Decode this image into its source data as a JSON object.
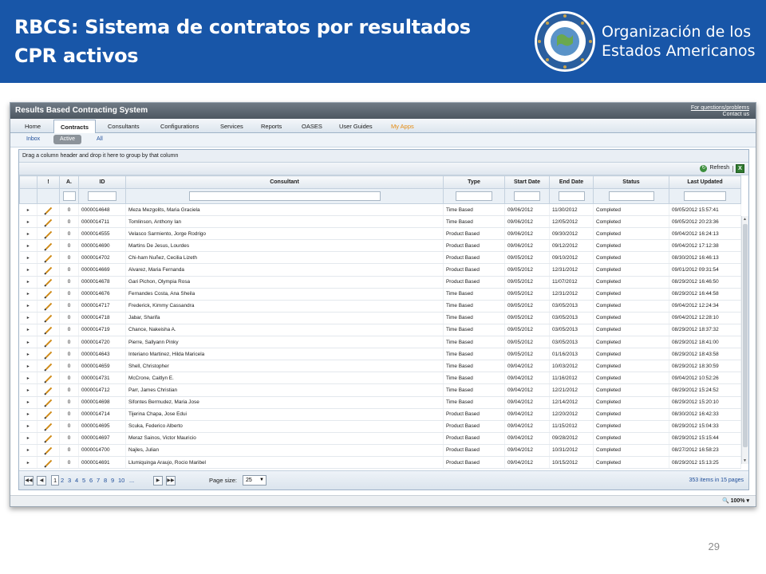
{
  "slide": {
    "title_line1": "RBCS: Sistema de contratos por resultados",
    "title_line2": "CPR activos",
    "org_line1": "Organización de los",
    "org_line2": "Estados Americanos",
    "page_number": "29"
  },
  "app": {
    "title": "Results Based Contracting System",
    "help_line1": "For questions/problems",
    "help_line2": "Contact us"
  },
  "menu": [
    "Home",
    "Contracts",
    "Consultants",
    "Configurations",
    "Services",
    "Reports",
    "OASES",
    "User Guides",
    "My Apps"
  ],
  "subtabs": [
    "Inbox",
    "Active",
    "All"
  ],
  "grid": {
    "group_hint": "Drag a column header and drop it here to group by that column",
    "refresh_label": "Refresh",
    "columns": [
      "!",
      "A.",
      "ID",
      "Consultant",
      "Type",
      "Start Date",
      "End Date",
      "Status",
      "Last Updated"
    ],
    "rows": [
      [
        "0",
        "0000014648",
        "Meza Mezgolits, Maria Graciela",
        "Time Based",
        "09/06/2012",
        "11/30/2012",
        "Completed",
        "09/05/2012 15:57:41"
      ],
      [
        "0",
        "0000014711",
        "Tomlinson, Anthony Ian",
        "Time Based",
        "09/06/2012",
        "12/05/2012",
        "Completed",
        "09/05/2012 20:23:36"
      ],
      [
        "0",
        "0000014555",
        "Velasco Sarmiento, Jorge Rodrigo",
        "Product Based",
        "09/06/2012",
        "09/30/2012",
        "Completed",
        "09/04/2012 16:24:13"
      ],
      [
        "0",
        "0000014690",
        "Martins De Jesus, Lourdes",
        "Product Based",
        "09/06/2012",
        "09/12/2012",
        "Completed",
        "09/04/2012 17:12:38"
      ],
      [
        "0",
        "0000014702",
        "Chi-ham Nuñez, Cecilia Lizeth",
        "Product Based",
        "09/05/2012",
        "09/10/2012",
        "Completed",
        "08/30/2012 16:46:13"
      ],
      [
        "0",
        "0000014669",
        "Alvarez, Maria Fernanda",
        "Product Based",
        "09/05/2012",
        "12/31/2012",
        "Completed",
        "09/01/2012 09:31:54"
      ],
      [
        "0",
        "0000014678",
        "Gari Pichon, Olympia Rosa",
        "Product Based",
        "09/05/2012",
        "11/07/2012",
        "Completed",
        "08/29/2012 16:46:50"
      ],
      [
        "0",
        "0000014676",
        "Fernandes Costa, Ana Sheila",
        "Time Based",
        "09/05/2012",
        "12/31/2012",
        "Completed",
        "08/29/2012 16:44:58"
      ],
      [
        "0",
        "0000014717",
        "Frederick, Kimmy Cassandra",
        "Time Based",
        "09/05/2012",
        "03/05/2013",
        "Completed",
        "09/04/2012 12:24:34"
      ],
      [
        "0",
        "0000014718",
        "Jabar, Sharifa",
        "Time Based",
        "09/05/2012",
        "03/05/2013",
        "Completed",
        "09/04/2012 12:28:10"
      ],
      [
        "0",
        "0000014719",
        "Chance, Nakeisha A.",
        "Time Based",
        "09/05/2012",
        "03/05/2013",
        "Completed",
        "08/29/2012 18:37:32"
      ],
      [
        "0",
        "0000014720",
        "Pierre, Sallyann Pinky",
        "Time Based",
        "09/05/2012",
        "03/05/2013",
        "Completed",
        "08/29/2012 18:41:00"
      ],
      [
        "0",
        "0000014643",
        "Interiano Martinez, Hilda Maricela",
        "Time Based",
        "09/05/2012",
        "01/16/2013",
        "Completed",
        "08/29/2012 18:43:58"
      ],
      [
        "0",
        "0000014659",
        "Shell, Christopher",
        "Time Based",
        "09/04/2012",
        "10/03/2012",
        "Completed",
        "08/29/2012 18:30:59"
      ],
      [
        "0",
        "0000014731",
        "McCrone, Caitlyn E.",
        "Time Based",
        "09/04/2012",
        "11/16/2012",
        "Completed",
        "09/04/2012 10:52:26"
      ],
      [
        "0",
        "0000014712",
        "Parr, James Christian",
        "Time Based",
        "09/04/2012",
        "12/21/2012",
        "Completed",
        "08/29/2012 15:24:52"
      ],
      [
        "0",
        "0000014698",
        "Sifontes Bermudez, Maria Jose",
        "Time Based",
        "09/04/2012",
        "12/14/2012",
        "Completed",
        "08/29/2012 15:20:10"
      ],
      [
        "0",
        "0000014714",
        "Tijerina Chapa, Jose Edui",
        "Product Based",
        "09/04/2012",
        "12/20/2012",
        "Completed",
        "08/30/2012 16:42:33"
      ],
      [
        "0",
        "0000014695",
        "Scuka, Federico Alberto",
        "Product Based",
        "09/04/2012",
        "11/15/2012",
        "Completed",
        "08/29/2012 15:04:33"
      ],
      [
        "0",
        "0000014697",
        "Meraz Sainos, Victor Mauricio",
        "Product Based",
        "09/04/2012",
        "09/28/2012",
        "Completed",
        "08/29/2012 15:15:44"
      ],
      [
        "0",
        "0000014700",
        "Najles, Julian",
        "Product Based",
        "09/04/2012",
        "10/31/2012",
        "Completed",
        "08/27/2012 16:58:23"
      ],
      [
        "0",
        "0000014691",
        "Llumiquinga Araujo, Rocio Maribel",
        "Product Based",
        "09/04/2012",
        "10/15/2012",
        "Completed",
        "08/29/2012 15:13:25"
      ]
    ]
  },
  "pager": {
    "pages": [
      "1",
      "2",
      "3",
      "4",
      "5",
      "6",
      "7",
      "8",
      "9",
      "10",
      "..."
    ],
    "page_size_label": "Page size:",
    "page_size": "25",
    "info": "353 items in 15 pages"
  },
  "zoom": "100%",
  "colors": {
    "header_blue": "#1856a8",
    "status_link": "#1f4e9a",
    "my_apps": "#e58c12"
  }
}
